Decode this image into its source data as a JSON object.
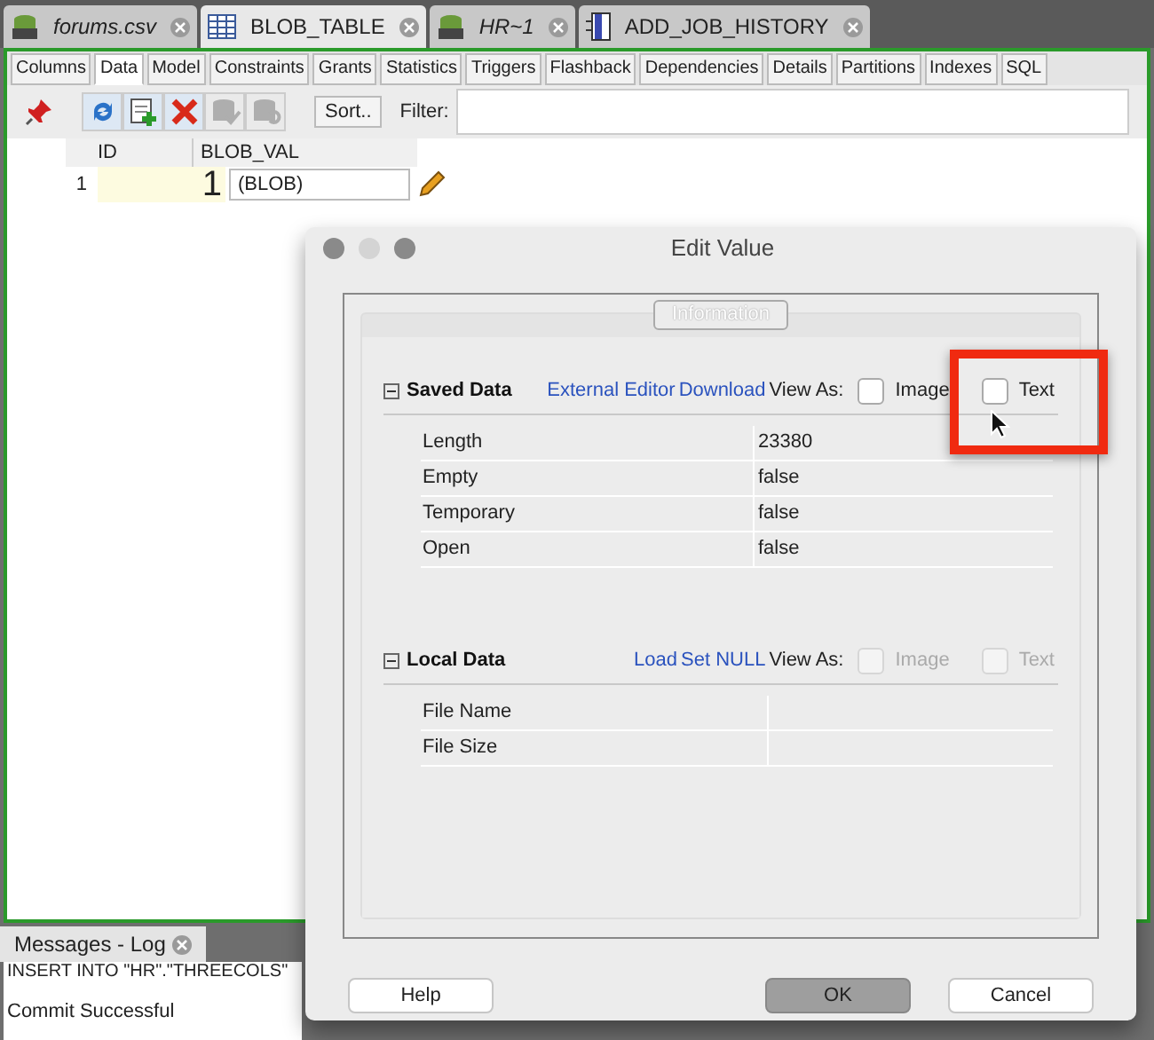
{
  "editor_tabs": [
    {
      "label": "forums.csv",
      "kind": "sql",
      "italic": true,
      "selected": false
    },
    {
      "label": "BLOB_TABLE",
      "kind": "table",
      "italic": false,
      "selected": true
    },
    {
      "label": "HR~1",
      "kind": "sql",
      "italic": true,
      "selected": false
    },
    {
      "label": "ADD_JOB_HISTORY",
      "kind": "proc",
      "italic": false,
      "selected": false
    }
  ],
  "sub_tabs": [
    {
      "label": "Columns",
      "selected": false
    },
    {
      "label": "Data",
      "selected": true
    },
    {
      "label": "Model",
      "selected": false
    },
    {
      "label": "Constraints",
      "selected": false
    },
    {
      "label": "Grants",
      "selected": false
    },
    {
      "label": "Statistics",
      "selected": false
    },
    {
      "label": "Triggers",
      "selected": false
    },
    {
      "label": "Flashback",
      "selected": false
    },
    {
      "label": "Dependencies",
      "selected": false
    },
    {
      "label": "Details",
      "selected": false
    },
    {
      "label": "Partitions",
      "selected": false
    },
    {
      "label": "Indexes",
      "selected": false
    },
    {
      "label": "SQL",
      "selected": false
    }
  ],
  "toolbar": {
    "tools": [
      {
        "kind": "refresh",
        "disabled": false
      },
      {
        "kind": "insert",
        "disabled": false
      },
      {
        "kind": "delete",
        "disabled": false
      },
      {
        "kind": "commit",
        "disabled": true
      },
      {
        "kind": "rollback",
        "disabled": true
      }
    ],
    "sort_button": "Sort..",
    "filter_label": "Filter:"
  },
  "table": {
    "columns": [
      "ID",
      "BLOB_VAL"
    ],
    "rows": [
      {
        "number": "1",
        "id": "1",
        "blob_val": "(BLOB)"
      }
    ]
  },
  "dialog": {
    "title": "Edit Value",
    "group_label": "Information",
    "sections": [
      {
        "title": "Saved Data",
        "links": [
          "External Editor",
          "Download"
        ],
        "view_as": "View As:",
        "options": [
          {
            "label": "Image",
            "checked": false,
            "disabled": false
          },
          {
            "label": "Text",
            "checked": false,
            "disabled": false
          }
        ],
        "properties": [
          {
            "name": "Length",
            "value": "23380"
          },
          {
            "name": "Empty",
            "value": "false"
          },
          {
            "name": "Temporary",
            "value": "false"
          },
          {
            "name": "Open",
            "value": "false"
          }
        ]
      },
      {
        "title": "Local Data",
        "links": [
          "Load",
          "Set NULL"
        ],
        "view_as": "View As:",
        "options": [
          {
            "label": "Image",
            "checked": false,
            "disabled": true
          },
          {
            "label": "Text",
            "checked": false,
            "disabled": true
          }
        ],
        "properties": [
          {
            "name": "File Name"
          },
          {
            "name": "File Size"
          }
        ]
      }
    ],
    "buttons": [
      {
        "label": "Help",
        "default": false
      },
      {
        "label": "OK",
        "default": true
      },
      {
        "label": "Cancel",
        "default": false
      }
    ]
  },
  "log": {
    "tab": "Messages - Log",
    "lines": [
      "INSERT INTO \"HR\".\"THREECOLS\"",
      "Commit Successful"
    ]
  }
}
